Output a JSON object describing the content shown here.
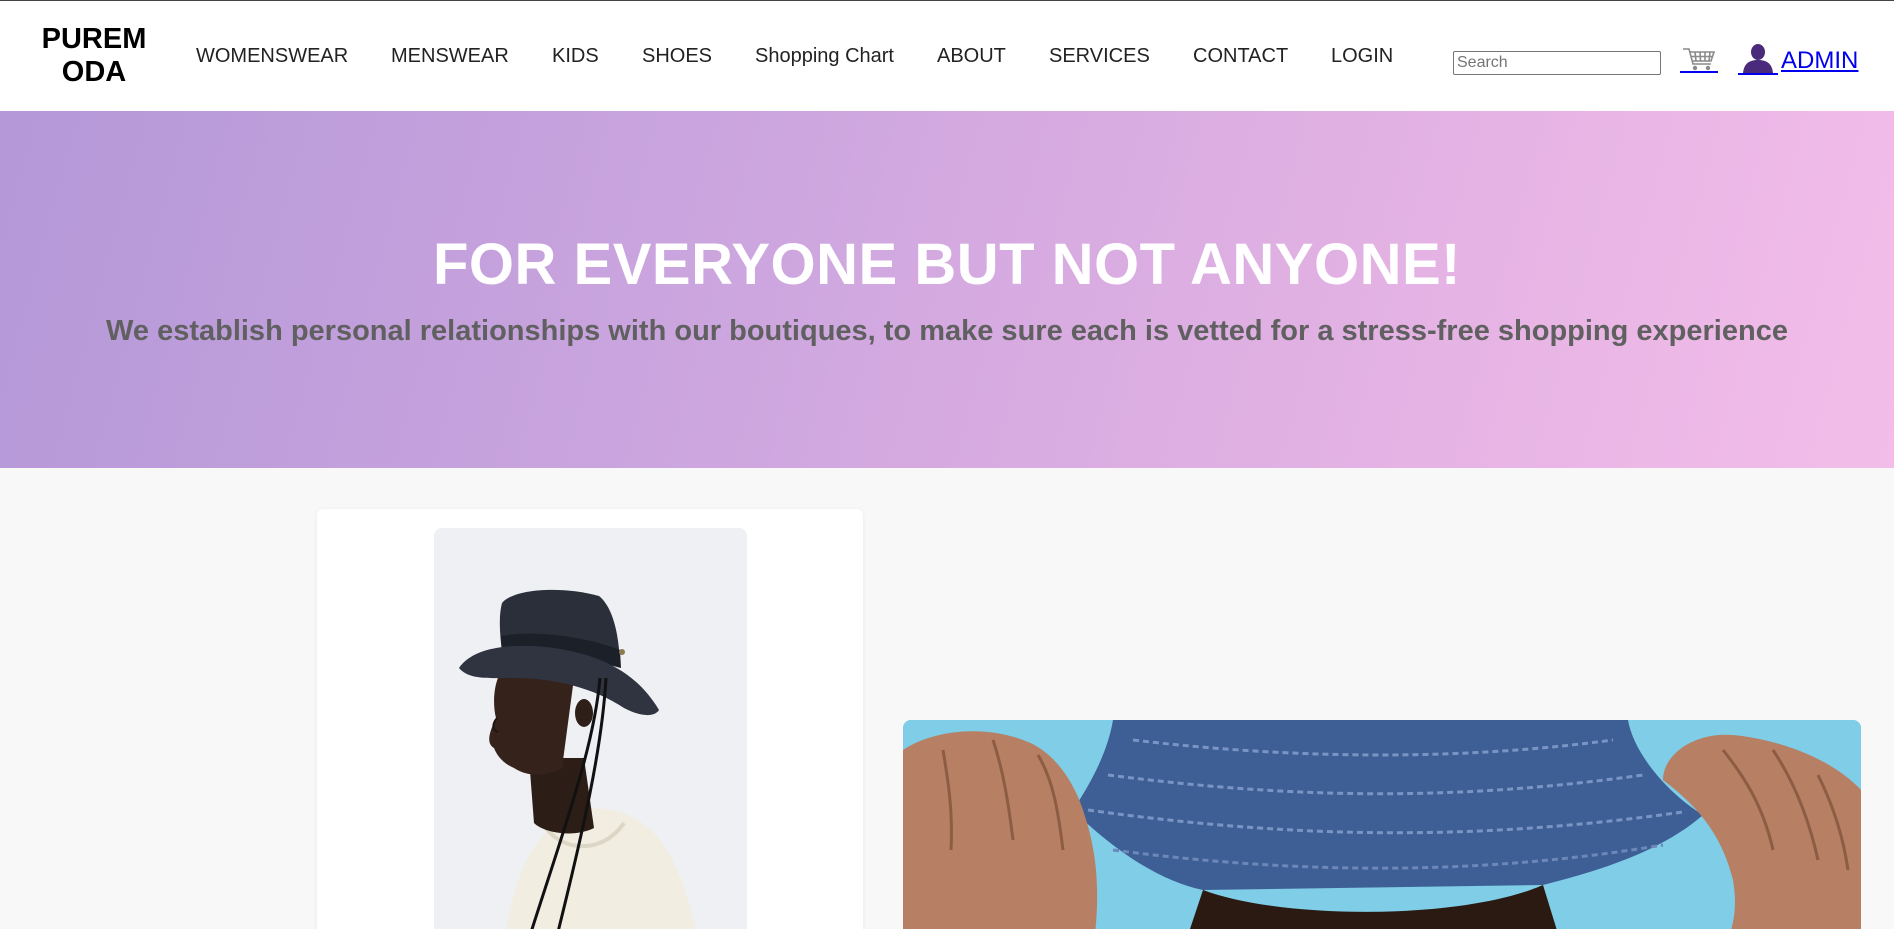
{
  "brand": {
    "logo_line1": "PUREM",
    "logo_line2": "ODA"
  },
  "nav": {
    "items": [
      {
        "label": "WOMENSWEAR"
      },
      {
        "label": "MENSWEAR"
      },
      {
        "label": "KIDS"
      },
      {
        "label": "SHOES"
      },
      {
        "label": "Shopping Chart"
      },
      {
        "label": "ABOUT"
      },
      {
        "label": "SERVICES"
      },
      {
        "label": "CONTACT"
      },
      {
        "label": "LOGIN"
      }
    ]
  },
  "search": {
    "placeholder": "Search",
    "value": ""
  },
  "user": {
    "cart_icon": "shopping-cart-icon",
    "avatar_icon": "user-silhouette-icon",
    "label": "ADMIN"
  },
  "hero": {
    "title": "FOR EVERYONE BUT NOT ANYONE!",
    "subtitle": "We establish personal relationships with our boutiques, to make sure each is vetted for a stress-free shopping experience"
  },
  "colors": {
    "hero_gradient_start": "#b498d8",
    "hero_gradient_end": "#f3bde9",
    "link": "#0000ee",
    "avatar": "#4a2a7a"
  }
}
